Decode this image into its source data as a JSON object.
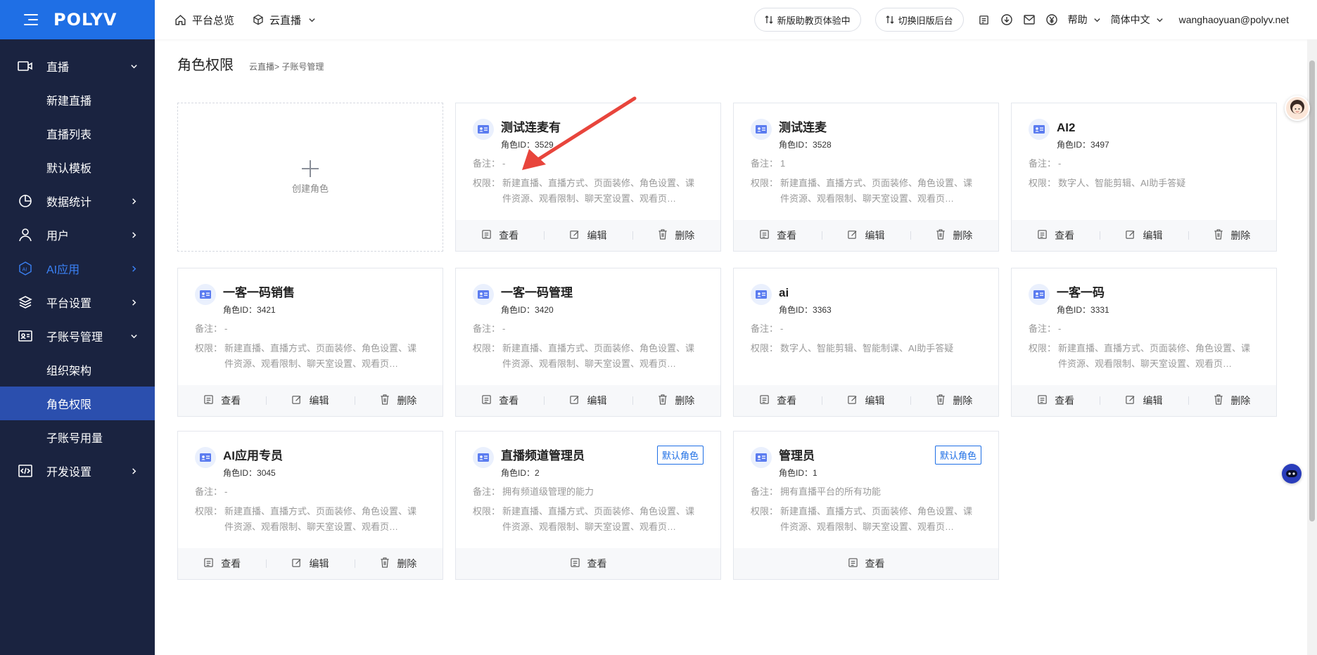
{
  "app": {
    "logo": "POLYV"
  },
  "topbar": {
    "overview": "平台总览",
    "product": "云直播",
    "new_page_btn": "新版助教页体验中",
    "old_console_btn": "切换旧版后台",
    "help": "帮助",
    "language": "简体中文",
    "user_email": "wanghaoyuan@polyv.net"
  },
  "sidebar": {
    "items": [
      {
        "label": "直播",
        "icon": "live-icon",
        "arrow": "down"
      },
      {
        "label": "新建直播",
        "sub": true
      },
      {
        "label": "直播列表",
        "sub": true
      },
      {
        "label": "默认模板",
        "sub": true
      },
      {
        "label": "数据统计",
        "icon": "chart-icon",
        "arrow": "right"
      },
      {
        "label": "用户",
        "icon": "user-icon",
        "arrow": "right"
      },
      {
        "label": "AI应用",
        "icon": "ai-icon",
        "arrow": "right"
      },
      {
        "label": "平台设置",
        "icon": "layers-icon",
        "arrow": "right"
      },
      {
        "label": "子账号管理",
        "icon": "id-card-icon",
        "arrow": "down"
      },
      {
        "label": "组织架构",
        "sub": true
      },
      {
        "label": "角色权限",
        "sub": true,
        "active": true
      },
      {
        "label": "子账号用量",
        "sub": true
      },
      {
        "label": "开发设置",
        "icon": "code-icon",
        "arrow": "right"
      }
    ]
  },
  "page": {
    "title": "角色权限",
    "breadcrumb": "云直播>  子账号管理",
    "create_label": "创建角色"
  },
  "labels": {
    "id_prefix": "角色ID：",
    "note_key": "备注：",
    "perm_key": "权限：",
    "view": "查看",
    "edit": "编辑",
    "delete": "删除",
    "default_role": "默认角色"
  },
  "roles": [
    {
      "name": "测试连麦有",
      "id": "3529",
      "note": "-",
      "perms": "新建直播、直播方式、页面装修、角色设置、课件资源、观看限制、聊天室设置、观看页…",
      "default": false
    },
    {
      "name": "测试连麦",
      "id": "3528",
      "note": "1",
      "perms": "新建直播、直播方式、页面装修、角色设置、课件资源、观看限制、聊天室设置、观看页…",
      "default": false
    },
    {
      "name": "AI2",
      "id": "3497",
      "note": "-",
      "perms": "数字人、智能剪辑、AI助手答疑",
      "default": false
    },
    {
      "name": "一客一码销售",
      "id": "3421",
      "note": "-",
      "perms": "新建直播、直播方式、页面装修、角色设置、课件资源、观看限制、聊天室设置、观看页…",
      "default": false
    },
    {
      "name": "一客一码管理",
      "id": "3420",
      "note": "-",
      "perms": "新建直播、直播方式、页面装修、角色设置、课件资源、观看限制、聊天室设置、观看页…",
      "default": false
    },
    {
      "name": "ai",
      "id": "3363",
      "note": "-",
      "perms": "数字人、智能剪辑、智能制课、AI助手答疑",
      "default": false
    },
    {
      "name": "一客一码",
      "id": "3331",
      "note": "-",
      "perms": "新建直播、直播方式、页面装修、角色设置、课件资源、观看限制、聊天室设置、观看页…",
      "default": false
    },
    {
      "name": "AI应用专员",
      "id": "3045",
      "note": "-",
      "perms": "新建直播、直播方式、页面装修、角色设置、课件资源、观看限制、聊天室设置、观看页…",
      "default": false
    },
    {
      "name": "直播频道管理员",
      "id": "2",
      "note": "拥有频道级管理的能力",
      "perms": "新建直播、直播方式、页面装修、角色设置、课件资源、观看限制、聊天室设置、观看页…",
      "default": true
    },
    {
      "name": "管理员",
      "id": "1",
      "note": "拥有直播平台的所有功能",
      "perms": "新建直播、直播方式、页面装修、角色设置、课件资源、观看限制、聊天室设置、观看页…",
      "default": true
    }
  ],
  "colors": {
    "brand": "#1f6fe5",
    "sidebar_bg": "#1a2340",
    "active_bg": "#2b4fae",
    "annotation": "#e8453c"
  }
}
